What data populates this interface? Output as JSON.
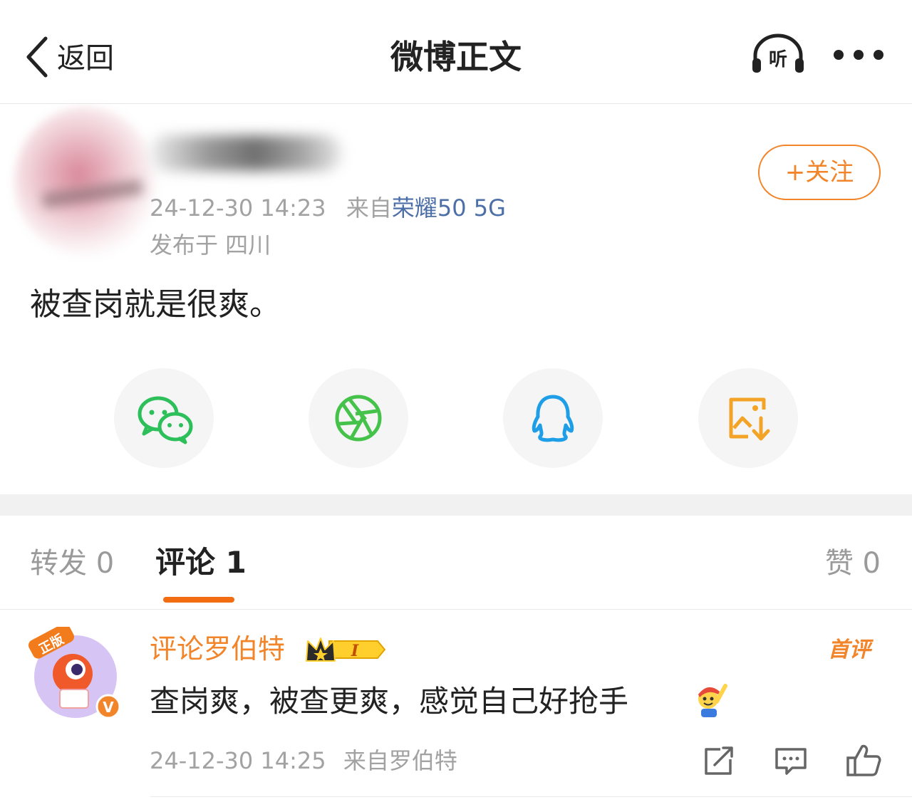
{
  "nav": {
    "back_label": "返回",
    "title": "微博正文",
    "listen_label": "听"
  },
  "post": {
    "timestamp": "24-12-30 14:23",
    "source_prefix": "来自",
    "device": "荣耀50 5G",
    "location": "发布于 四川",
    "follow_label": "+关注",
    "text": "被查岗就是很爽。"
  },
  "share": {
    "items": [
      "wechat-icon",
      "moments-icon",
      "qq-icon",
      "save-image-icon"
    ],
    "colors": {
      "wechat": "#2cbf5a",
      "moments": "#45c24a",
      "qq": "#1f9ee8",
      "save": "#f3a326"
    }
  },
  "tabs": {
    "repost": "转发 0",
    "comment": "评论 1",
    "like": "赞 0"
  },
  "comment": {
    "author": "评论罗伯特",
    "badge_level": "I",
    "first_tag": "首评",
    "text": "查岗爽，被查更爽，感觉自己好抢手",
    "timestamp": "24-12-30 14:25",
    "source": "来自罗伯特",
    "avatar_tag": "正版"
  },
  "colors": {
    "accent": "#f2842a",
    "tab_indicator": "#f26d12",
    "link_blue": "#4d6fa8",
    "meta_gray": "#a2a2a2"
  }
}
